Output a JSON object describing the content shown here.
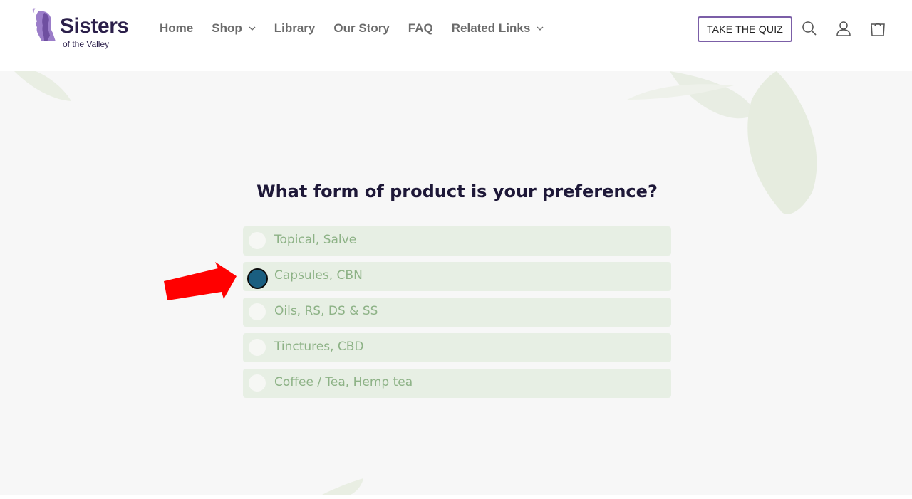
{
  "header": {
    "logo": {
      "title": "Sisters",
      "subtitle": "of the Valley"
    },
    "nav": [
      {
        "label": "Home",
        "has_dropdown": false
      },
      {
        "label": "Shop",
        "has_dropdown": true
      },
      {
        "label": "Library",
        "has_dropdown": false
      },
      {
        "label": "Our Story",
        "has_dropdown": false
      },
      {
        "label": "FAQ",
        "has_dropdown": false
      },
      {
        "label": "Related Links",
        "has_dropdown": true
      }
    ],
    "quiz_button": "TAKE THE QUIZ",
    "icons": [
      "search-icon",
      "account-icon",
      "cart-icon"
    ]
  },
  "quiz": {
    "question": "What form of product is your preference?",
    "options": [
      {
        "label": "Topical, Salve",
        "selected": false
      },
      {
        "label": "Capsules, CBN",
        "selected": true
      },
      {
        "label": "Oils, RS, DS & SS",
        "selected": false
      },
      {
        "label": "Tinctures, CBD",
        "selected": false
      },
      {
        "label": "Coffee / Tea, Hemp tea",
        "selected": false
      }
    ]
  },
  "annotation": {
    "arrow_color": "#ff0000"
  },
  "colors": {
    "brand_purple": "#7b5ea7",
    "brand_dark": "#2b1f4a",
    "option_bg": "#e7efe4",
    "option_text": "#8db286",
    "selected_radio": "#1a5e80"
  }
}
